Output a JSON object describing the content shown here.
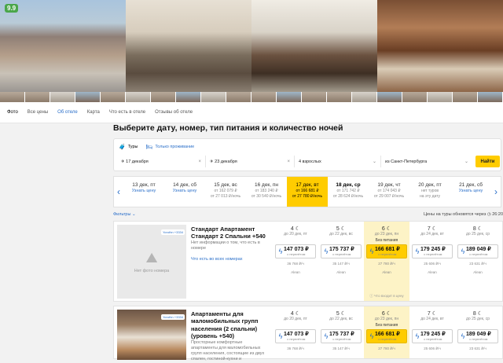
{
  "hotel": {
    "rating": "9.9"
  },
  "tabs": [
    {
      "label": "Фото",
      "state": "active"
    },
    {
      "label": "Все цены",
      "state": ""
    },
    {
      "label": "Об отеле",
      "state": "link"
    },
    {
      "label": "Карта",
      "state": ""
    },
    {
      "label": "Что есть в отеле",
      "state": ""
    },
    {
      "label": "Отзывы об отеле",
      "state": ""
    }
  ],
  "heading": "Выберите дату, номер, тип питания и количество ночей",
  "search": {
    "mode_tours": "Туры",
    "mode_stay": "Только проживание",
    "date_from": "17 декабря",
    "date_to": "23 декабря",
    "guests": "4 взрослых",
    "departure": "из Санкт-Петербурга",
    "find": "Найти"
  },
  "dates": [
    {
      "d": "13 дек, пт",
      "a": "",
      "b": "",
      "l": "Узнать цену"
    },
    {
      "d": "14 дек, сб",
      "a": "",
      "b": "",
      "l": "Узнать цену"
    },
    {
      "d": "15 дек, вс",
      "a": "от 162 079 ₽",
      "b": "от 27 013 ₽/ночь",
      "l": ""
    },
    {
      "d": "16 дек, пн",
      "a": "от 183 240 ₽",
      "b": "от 30 540 ₽/ночь",
      "l": ""
    },
    {
      "d": "17 дек, вт",
      "a": "от 166 681 ₽",
      "b": "от 27 780 ₽/ночь",
      "l": "",
      "sel": true
    },
    {
      "d": "18 дек, ср",
      "a": "от 171 742 ₽",
      "b": "от 28 624 ₽/ночь",
      "l": "",
      "bold": true
    },
    {
      "d": "19 дек, чт",
      "a": "от 174 043 ₽",
      "b": "от 29 007 ₽/ночь",
      "l": ""
    },
    {
      "d": "20 дек, пт",
      "a": "нет туров",
      "b": "на эту дату",
      "l": ""
    },
    {
      "d": "21 дек, сб",
      "a": "",
      "b": "",
      "l": "Узнать цену"
    }
  ],
  "filters": {
    "label": "Фильтры",
    "update_note": "Цены на туры обновятся через",
    "timer": "26:20"
  },
  "rooms": [
    {
      "badge": "Yoruthn +3334",
      "title": "Стандарт Апартамент Стандарт 2 Спальни +540",
      "no_photo": "Нет фото номера",
      "note": "Нет информации о том, что есть в номере",
      "link": "Что есть во всех номерах",
      "columns": [
        {
          "n": "4",
          "dd": "до 20 дек, пт",
          "lbl": "",
          "price": "147 073 ₽",
          "sub": "с перелётом",
          "pp": "36 768 ₽/ч",
          "op": "Alean",
          "hl": false
        },
        {
          "n": "5",
          "dd": "до 22 дек, вс",
          "lbl": "",
          "price": "175 737 ₽",
          "sub": "с перелётом",
          "pp": "35 147 ₽/ч",
          "op": "Alean",
          "hl": false
        },
        {
          "n": "6",
          "dd": "до 23 дек, пн",
          "lbl": "Без питания",
          "price": "166 681 ₽",
          "sub": "с перелётом",
          "pp": "27 780 ₽/ч",
          "op": "Alean",
          "hl": true
        },
        {
          "n": "7",
          "dd": "до 24 дек, вт",
          "lbl": "",
          "price": "179 245 ₽",
          "sub": "с перелётом",
          "pp": "25 606 ₽/ч",
          "op": "Alean",
          "hl": false
        },
        {
          "n": "8",
          "dd": "до 25 дек, ср",
          "lbl": "",
          "price": "189 049 ₽",
          "sub": "с перелётом",
          "pp": "23 631 ₽/ч",
          "op": "Alean",
          "hl": false
        }
      ],
      "included": "Что входит в цену"
    },
    {
      "badge": "Yoruthn +3334",
      "title": "Апартаменты для маломобильных групп населения (2 спальни) (уровень +540)",
      "note": "Просторные комфортные апартаменты для маломобильных групп населения, состоящие из двух спален, гостиной-кухни и",
      "columns": [
        {
          "n": "4",
          "dd": "до 20 дек, пт",
          "lbl": "",
          "price": "147 073 ₽",
          "sub": "с перелётом",
          "pp": "36 768 ₽/ч",
          "hl": false
        },
        {
          "n": "5",
          "dd": "до 22 дек, вс",
          "lbl": "",
          "price": "175 737 ₽",
          "sub": "с перелётом",
          "pp": "35 147 ₽/ч",
          "hl": false
        },
        {
          "n": "6",
          "dd": "до 23 дек, пн",
          "lbl": "Без питания",
          "price": "166 681 ₽",
          "sub": "с перелётом",
          "pp": "27 780 ₽/ч",
          "hl": true
        },
        {
          "n": "7",
          "dd": "до 24 дек, вт",
          "lbl": "",
          "price": "179 245 ₽",
          "sub": "с перелётом",
          "pp": "25 606 ₽/ч",
          "hl": false
        },
        {
          "n": "8",
          "dd": "до 25 дек, ср",
          "lbl": "",
          "price": "189 049 ₽",
          "sub": "с перелётом",
          "pp": "23 631 ₽/ч",
          "hl": false
        }
      ]
    }
  ]
}
